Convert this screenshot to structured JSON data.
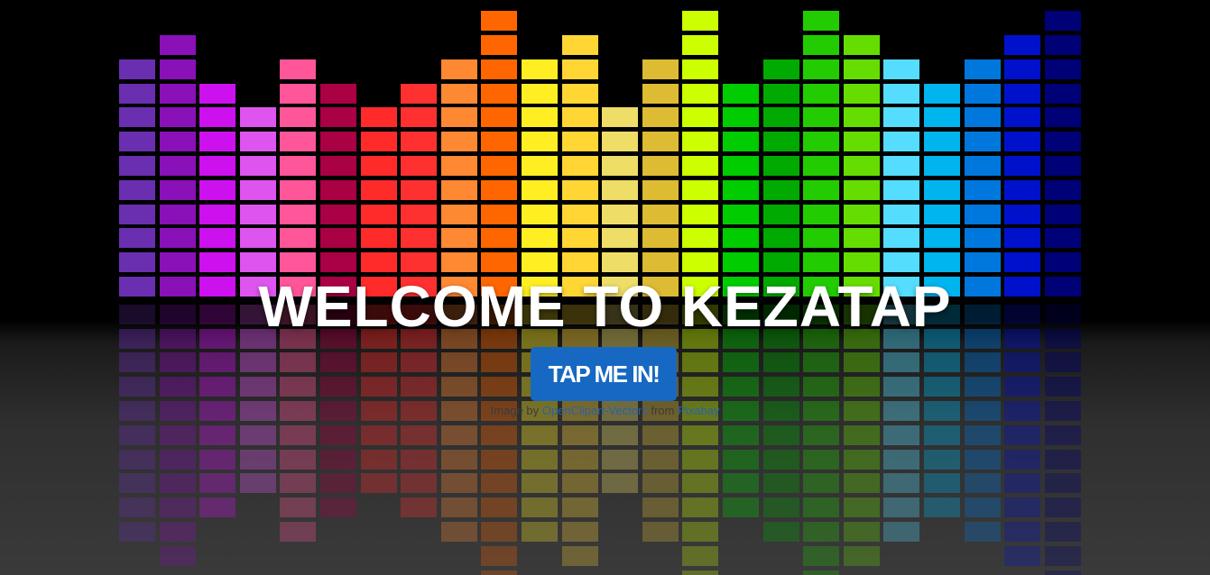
{
  "hero": {
    "title": "WELCOME TO KEZATAP",
    "button_label": "TAP ME IN!"
  },
  "credit": {
    "prefix": "Image by",
    "author_link": "OpenClipart-Vectors",
    "middle": "from",
    "source_link": "Pixabay"
  },
  "equalizer": {
    "columns": [
      {
        "color": "#6a2fb0",
        "level": 10
      },
      {
        "color": "#8a10b8",
        "level": 11
      },
      {
        "color": "#cc11ee",
        "level": 9
      },
      {
        "color": "#dd55ee",
        "level": 8
      },
      {
        "color": "#ff5599",
        "level": 10
      },
      {
        "color": "#aa0044",
        "level": 9
      },
      {
        "color": "#ff2a2a",
        "level": 8
      },
      {
        "color": "#ff3030",
        "level": 9
      },
      {
        "color": "#ff8833",
        "level": 10
      },
      {
        "color": "#ff6600",
        "level": 12
      },
      {
        "color": "#ffee22",
        "level": 10
      },
      {
        "color": "#ffd633",
        "level": 11
      },
      {
        "color": "#eedd66",
        "level": 8
      },
      {
        "color": "#ddbb33",
        "level": 10
      },
      {
        "color": "#ccff00",
        "level": 12
      },
      {
        "color": "#00cc00",
        "level": 9
      },
      {
        "color": "#00aa00",
        "level": 10
      },
      {
        "color": "#22cc00",
        "level": 12
      },
      {
        "color": "#66dd00",
        "level": 11
      },
      {
        "color": "#55ddff",
        "level": 10
      },
      {
        "color": "#00b4ee",
        "level": 9
      },
      {
        "color": "#0077dd",
        "level": 10
      },
      {
        "color": "#0011cc",
        "level": 11
      },
      {
        "color": "#000077",
        "level": 12
      }
    ]
  }
}
